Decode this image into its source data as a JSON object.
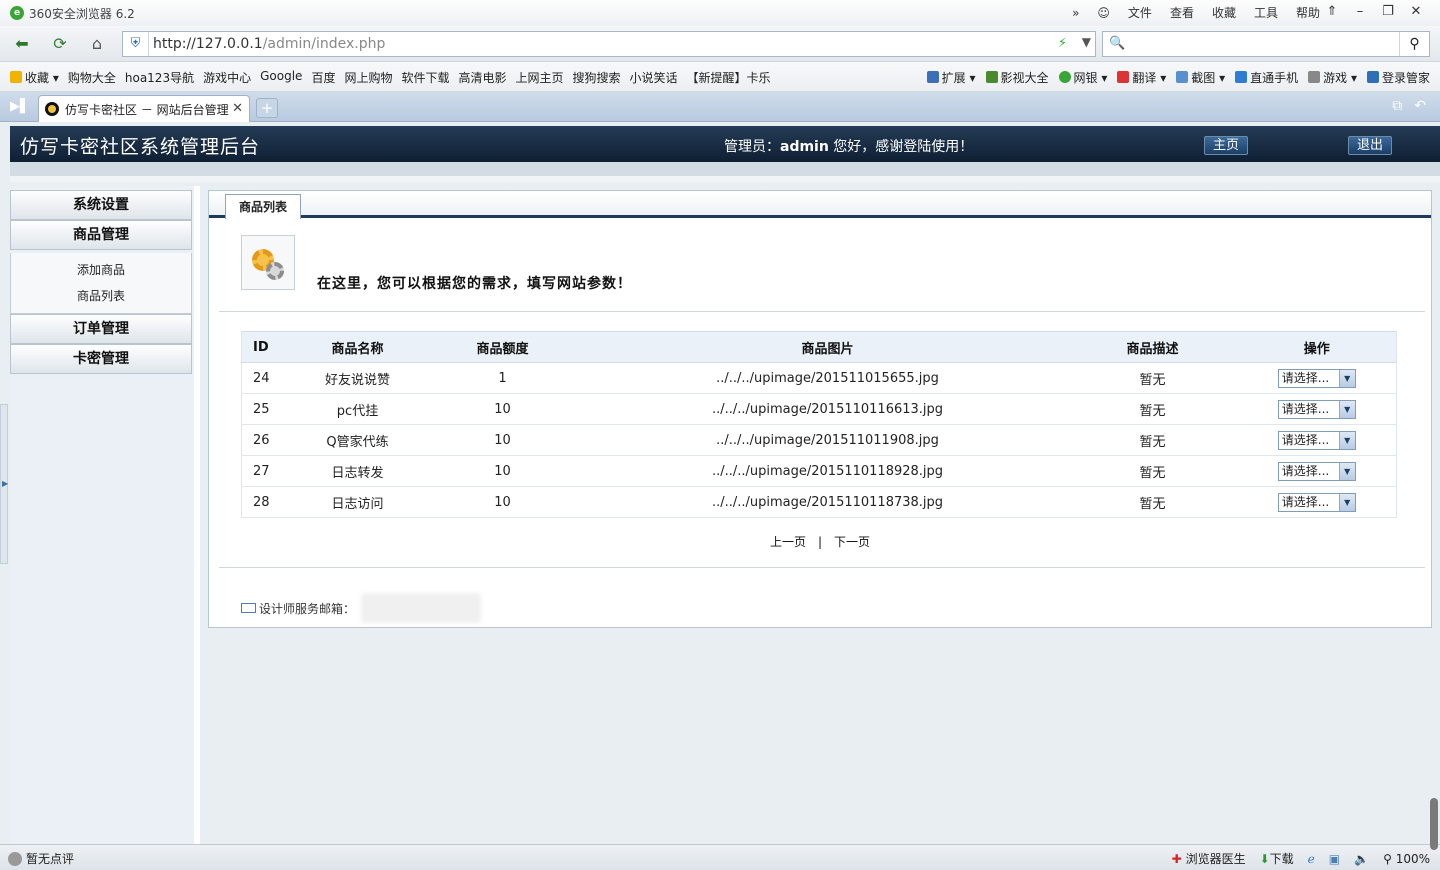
{
  "browser": {
    "app_title": "360安全浏览器 6.2",
    "menus": [
      "文件",
      "查看",
      "收藏",
      "工具",
      "帮助"
    ],
    "url_host": "http://127.0.0.1",
    "url_path": "/admin/index.php",
    "favorites_left": [
      "收藏",
      "购物大全",
      "hoa123导航",
      "游戏中心",
      "Google",
      "百度",
      "网上购物",
      "软件下载",
      "高清电影",
      "上网主页",
      "搜狗搜索",
      "小说笑话",
      "【新提醒】卡乐"
    ],
    "favorites_right": [
      "扩展",
      "影视大全",
      "网银",
      "翻译",
      "截图",
      "直通手机",
      "游戏",
      "登录管家"
    ],
    "tab_title": "仿写卡密社区 － 网站后台管理",
    "new_tab": "+",
    "status_left": "暂无点评",
    "status_right": [
      "浏览器医生",
      "下载",
      "100%"
    ]
  },
  "header": {
    "title": "仿写卡密社区系统管理后台",
    "welcome_prefix": "管理员：",
    "admin_name": "admin",
    "welcome_suffix": "您好，感谢登陆使用！",
    "home_button": "主页",
    "logout_button": "退出"
  },
  "sidebar": {
    "system": "系统设置",
    "goods": "商品管理",
    "goods_sub": [
      "添加商品",
      "商品列表"
    ],
    "orders": "订单管理",
    "cards": "卡密管理"
  },
  "main": {
    "tab_label": "商品列表",
    "intro": "在这里，您可以根据您的需求，填写网站参数！",
    "columns": [
      "ID",
      "商品名称",
      "商品额度",
      "商品图片",
      "商品描述",
      "操作"
    ],
    "rows": [
      {
        "id": "24",
        "name": "好友说说赞",
        "quota": "1",
        "image": "../../../upimage/201511015655.jpg",
        "desc": "暂无",
        "action": "请选择..."
      },
      {
        "id": "25",
        "name": "pc代挂",
        "quota": "10",
        "image": "../../../upimage/2015110116613.jpg",
        "desc": "暂无",
        "action": "请选择..."
      },
      {
        "id": "26",
        "name": "Q管家代练",
        "quota": "10",
        "image": "../../../upimage/201511011908.jpg",
        "desc": "暂无",
        "action": "请选择..."
      },
      {
        "id": "27",
        "name": "日志转发",
        "quota": "10",
        "image": "../../../upimage/2015110118928.jpg",
        "desc": "暂无",
        "action": "请选择..."
      },
      {
        "id": "28",
        "name": "日志访问",
        "quota": "10",
        "image": "../../../upimage/2015110118738.jpg",
        "desc": "暂无",
        "action": "请选择..."
      }
    ],
    "prev": "上一页",
    "separator": "|",
    "next": "下一页",
    "email_label": "设计师服务邮箱："
  }
}
